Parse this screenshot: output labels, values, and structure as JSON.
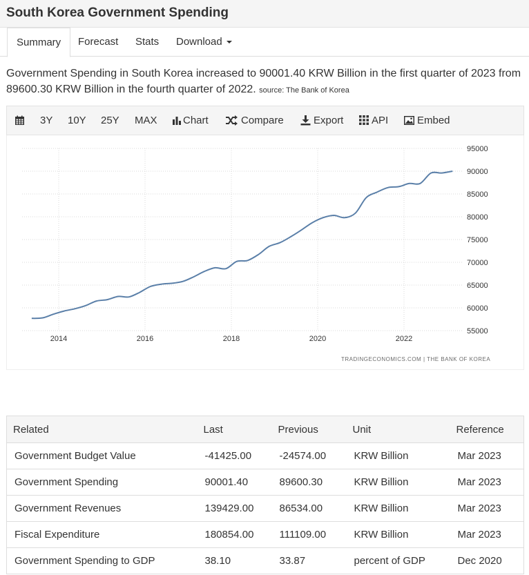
{
  "page": {
    "title": "South Korea Government Spending"
  },
  "tabs": [
    {
      "label": "Summary",
      "active": true
    },
    {
      "label": "Forecast"
    },
    {
      "label": "Stats"
    },
    {
      "label": "Download"
    }
  ],
  "description": {
    "text": "Government Spending in South Korea increased to 90001.40 KRW Billion in the first quarter of 2023 from 89600.30 KRW Billion in the fourth quarter of 2022.",
    "source": "source: The Bank of Korea"
  },
  "toolbar": {
    "calendar_icon": "calendar-icon",
    "ranges": [
      "3Y",
      "10Y",
      "25Y",
      "MAX"
    ],
    "chart_label": "Chart",
    "compare_label": "Compare",
    "export_label": "Export",
    "api_label": "API",
    "embed_label": "Embed"
  },
  "chart_data": {
    "type": "line",
    "line_color": "#5a7fa8",
    "grid": true,
    "yaxis_position": "right",
    "ylim": [
      55000,
      95000
    ],
    "y_ticks": [
      95000,
      90000,
      85000,
      80000,
      75000,
      70000,
      65000,
      60000,
      55000
    ],
    "x_ticks": [
      "2014",
      "2016",
      "2018",
      "2020",
      "2022"
    ],
    "series": [
      {
        "x": [
          "2013 Q2",
          "2013 Q3",
          "2013 Q4",
          "2014 Q1",
          "2014 Q2",
          "2014 Q3",
          "2014 Q4",
          "2015 Q1",
          "2015 Q2",
          "2015 Q3",
          "2015 Q4",
          "2016 Q1",
          "2016 Q2",
          "2016 Q3",
          "2016 Q4",
          "2017 Q1",
          "2017 Q2",
          "2017 Q3",
          "2017 Q4",
          "2018 Q1",
          "2018 Q2",
          "2018 Q3",
          "2018 Q4",
          "2019 Q1",
          "2019 Q2",
          "2019 Q3",
          "2019 Q4",
          "2020 Q1",
          "2020 Q2",
          "2020 Q3",
          "2020 Q4",
          "2021 Q1",
          "2021 Q2",
          "2021 Q3",
          "2021 Q4",
          "2022 Q1",
          "2022 Q2",
          "2022 Q3",
          "2022 Q4",
          "2023 Q1"
        ],
        "values": [
          57700,
          57800,
          58600,
          59300,
          59800,
          60500,
          61500,
          61800,
          62500,
          62400,
          63400,
          64700,
          65200,
          65400,
          65800,
          66800,
          68000,
          68800,
          68600,
          70200,
          70400,
          71700,
          73500,
          74300,
          75600,
          77100,
          78700,
          79800,
          80300,
          79800,
          80800,
          84200,
          85400,
          86400,
          86600,
          87300,
          87300,
          89600,
          89600,
          90001.4
        ]
      }
    ],
    "watermark": "TRADINGECONOMICS.COM  |  THE BANK OF KOREA"
  },
  "table": {
    "headers": [
      "Related",
      "Last",
      "Previous",
      "Unit",
      "Reference"
    ],
    "rows": [
      [
        "Government Budget Value",
        "-41425.00",
        "-24574.00",
        "KRW Billion",
        "Mar 2023"
      ],
      [
        "Government Spending",
        "90001.40",
        "89600.30",
        "KRW Billion",
        "Mar 2023"
      ],
      [
        "Government Revenues",
        "139429.00",
        "86534.00",
        "KRW Billion",
        "Mar 2023"
      ],
      [
        "Fiscal Expenditure",
        "180854.00",
        "111109.00",
        "KRW Billion",
        "Mar 2023"
      ],
      [
        "Government Spending to GDP",
        "38.10",
        "33.87",
        "percent of GDP",
        "Dec 2020"
      ]
    ]
  }
}
